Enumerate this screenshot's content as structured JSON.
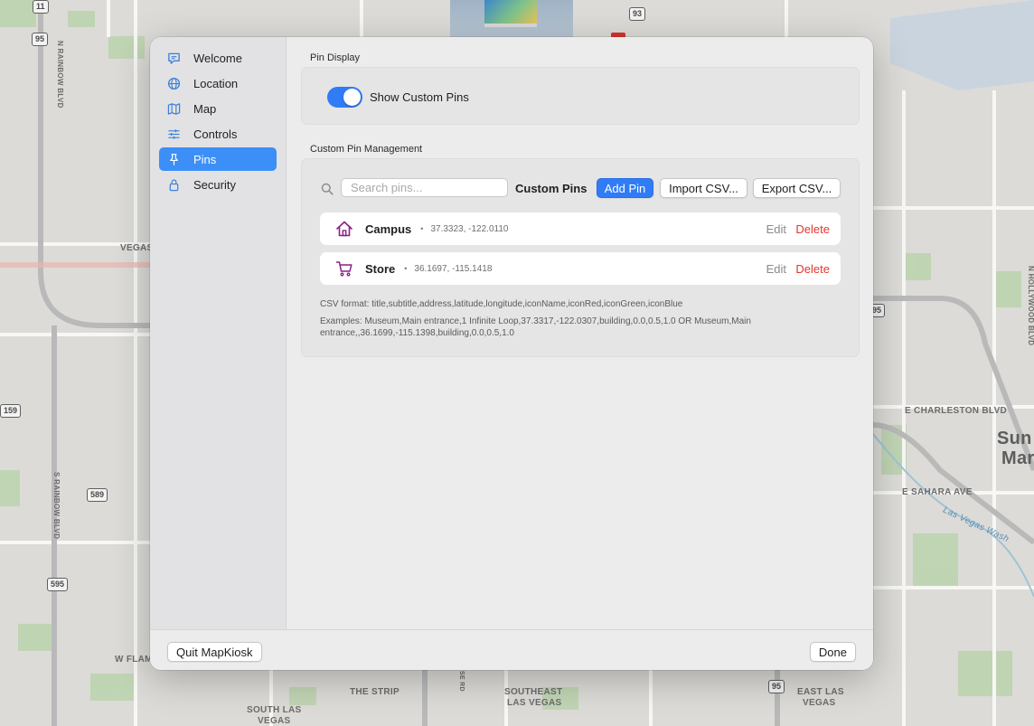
{
  "map": {
    "labels": {
      "n_rainbow": "N RAINBOW BLVD",
      "s_rainbow": "S RAINBOW BLVD",
      "vegas": "VEGAS",
      "w_flam": "W FLAM",
      "the_strip": "THE STRIP",
      "southeast_1": "SOUTHEAST",
      "southeast_2": "LAS VEGAS",
      "south_las_1": "SOUTH LAS",
      "south_las_2": "VEGAS",
      "east_las_1": "EAST LAS",
      "east_las_2": "VEGAS",
      "e_charleston": "E CHARLESTON BLVD",
      "e_sahara": "E SAHARA AVE",
      "las_vegas_wash": "Las Vegas Wash",
      "n_hollywood": "N HOLLYWOOD BLVD",
      "sun_1": "Sun",
      "sun_2": "Mar",
      "se_rd": "SE RD"
    },
    "shields": {
      "i11": "11",
      "r95a": "95",
      "r93": "93",
      "r159": "159",
      "r589": "589",
      "r595": "595",
      "r95b": "95",
      "r95c": "95"
    }
  },
  "sidebar": {
    "items": [
      {
        "label": "Welcome",
        "icon": "speech-bubble-icon"
      },
      {
        "label": "Location",
        "icon": "globe-icon"
      },
      {
        "label": "Map",
        "icon": "map-icon"
      },
      {
        "label": "Controls",
        "icon": "sliders-icon"
      },
      {
        "label": "Pins",
        "icon": "pin-icon"
      },
      {
        "label": "Security",
        "icon": "lock-icon"
      }
    ],
    "active": "Pins"
  },
  "pin_display": {
    "section_title": "Pin Display",
    "toggle_label": "Show Custom Pins",
    "toggle_on": true
  },
  "management": {
    "section_title": "Custom Pin Management",
    "search_placeholder": "Search pins...",
    "toolbar_title": "Custom Pins",
    "add_label": "Add Pin",
    "import_label": "Import CSV...",
    "export_label": "Export CSV...",
    "pins": [
      {
        "title": "Campus",
        "coords": "37.3323, -122.0110",
        "icon": "house-icon",
        "edit": "Edit",
        "delete": "Delete"
      },
      {
        "title": "Store",
        "coords": "36.1697, -115.1418",
        "icon": "cart-icon",
        "edit": "Edit",
        "delete": "Delete"
      }
    ],
    "separator": "•",
    "csv_format": "CSV format: title,subtitle,address,latitude,longitude,iconName,iconRed,iconGreen,iconBlue",
    "csv_examples": "Examples: Museum,Main entrance,1 Infinite Loop,37.3317,-122.0307,building,0.0,0.5,1.0  OR  Museum,Main entrance,,36.1699,-115.1398,building,0.0,0.5,1.0"
  },
  "footer": {
    "quit_label": "Quit MapKiosk",
    "done_label": "Done"
  },
  "colors": {
    "accent": "#2f7cf6",
    "delete": "#e5352e",
    "pin_icon": "#8a1f86"
  }
}
